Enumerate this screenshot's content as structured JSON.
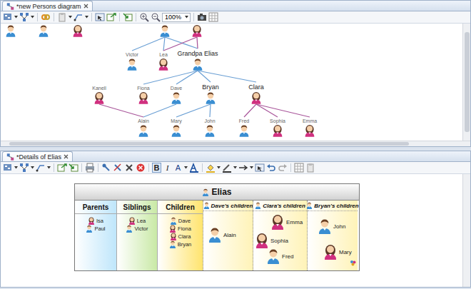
{
  "diagram": {
    "tab": {
      "label": "*new Persons diagram",
      "selected": true
    },
    "toolbar": {
      "zoom": "100%"
    },
    "nodes": [
      {
        "kind": "man"
      },
      {
        "kind": "man"
      },
      {
        "kind": "woman"
      },
      {
        "kind": "man"
      },
      {
        "kind": "woman"
      },
      {
        "kind": "man",
        "label": "Victor",
        "emphasized": false
      },
      {
        "kind": "woman",
        "label": "Lea",
        "emphasized": false
      },
      {
        "kind": "man",
        "label": "Grandpa Elias",
        "emphasized": true
      },
      {
        "kind": "woman",
        "label": "Kanell",
        "emphasized": false
      },
      {
        "kind": "woman",
        "label": "Fiona",
        "emphasized": false
      },
      {
        "kind": "man",
        "label": "Dave",
        "emphasized": false
      },
      {
        "kind": "man",
        "label": "Bryan",
        "emphasized": true
      },
      {
        "kind": "woman",
        "label": "Clara",
        "emphasized": true
      },
      {
        "kind": "man",
        "label": "Alain",
        "emphasized": false
      },
      {
        "kind": "man",
        "label": "Mary",
        "emphasized": false
      },
      {
        "kind": "man",
        "label": "John",
        "emphasized": false
      },
      {
        "kind": "man",
        "label": "Fred",
        "emphasized": false
      },
      {
        "kind": "woman",
        "label": "Sophia",
        "emphasized": false
      },
      {
        "kind": "woman",
        "label": "Emma",
        "emphasized": false
      }
    ]
  },
  "details": {
    "tab": {
      "label": "*Details of Elias",
      "selected": true
    },
    "toolbar": {
      "format": [
        {
          "label": "B",
          "selected": true
        },
        {
          "label": "I",
          "selected": false
        },
        {
          "label": "A",
          "selected": false
        }
      ]
    },
    "table": {
      "title": "Elias",
      "columns": [
        {
          "header": "Parents",
          "kind": "list",
          "color": "#bfe6fb",
          "items": [
            {
              "name": "Isa",
              "kind": "woman"
            },
            {
              "name": "Paul",
              "kind": "man"
            }
          ]
        },
        {
          "header": "Siblings",
          "kind": "list",
          "color": "#c9e9a6",
          "items": [
            {
              "name": "Lea",
              "kind": "woman"
            },
            {
              "name": "Victor",
              "kind": "man"
            }
          ]
        },
        {
          "header": "Children",
          "kind": "list",
          "color": "#ffe46e",
          "items": [
            {
              "name": "Dave",
              "kind": "man"
            },
            {
              "name": "Fiona",
              "kind": "woman"
            },
            {
              "name": "Clara",
              "kind": "woman"
            },
            {
              "name": "Bryan",
              "kind": "man"
            }
          ]
        },
        {
          "header": "Dave's children",
          "kind": "family",
          "color": "#fff3b8",
          "items": [
            {
              "name": "Alain",
              "kind": "man"
            }
          ]
        },
        {
          "header": "Clara's children",
          "kind": "family",
          "color": "#fff3b8",
          "items": [
            {
              "name": "Emma",
              "kind": "woman"
            },
            {
              "name": "Sophia",
              "kind": "woman"
            },
            {
              "name": "Fred",
              "kind": "man"
            }
          ]
        },
        {
          "header": "Bryan's children",
          "kind": "family",
          "color": "#fff3b8",
          "items": [
            {
              "name": "John",
              "kind": "man"
            },
            {
              "name": "Mary",
              "kind": "woman"
            }
          ]
        }
      ]
    }
  }
}
